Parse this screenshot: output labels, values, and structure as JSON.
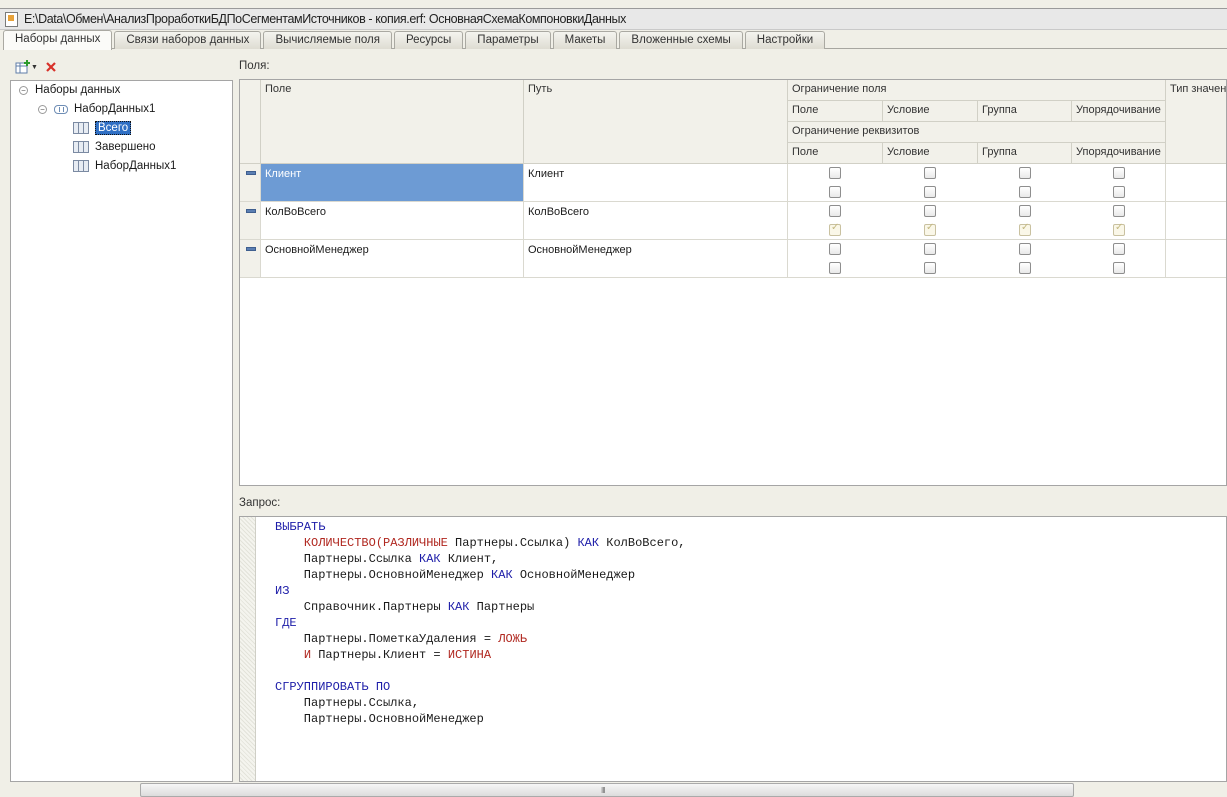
{
  "window": {
    "title": "E:\\Data\\Обмен\\АнализПроработкиБДПоСегментамИсточников - копия.erf: ОсновнаяСхемаКомпоновкиДанных"
  },
  "tabs": [
    {
      "label": "Наборы данных",
      "active": true
    },
    {
      "label": "Связи наборов данных"
    },
    {
      "label": "Вычисляемые поля"
    },
    {
      "label": "Ресурсы"
    },
    {
      "label": "Параметры"
    },
    {
      "label": "Макеты"
    },
    {
      "label": "Вложенные схемы"
    },
    {
      "label": "Настройки"
    }
  ],
  "toolbar": {
    "add_icon": "add-table-icon",
    "delete_icon": "delete-icon"
  },
  "tree": {
    "root": "Наборы данных",
    "dataset": "НаборДанных1",
    "items": [
      "Всего",
      "Завершено",
      "НаборДанных1"
    ],
    "selected": "Всего"
  },
  "fields": {
    "label": "Поля:",
    "headers": {
      "field": "Поле",
      "path": "Путь",
      "restriction_group": "Ограничение поля",
      "restriction_sub": [
        "Поле",
        "Условие",
        "Группа",
        "Упорядочивание"
      ],
      "attr_restriction_group": "Ограничение реквизитов",
      "attr_restriction_sub": [
        "Поле",
        "Условие",
        "Группа",
        "Упорядочивание"
      ],
      "value_type": "Тип значения"
    },
    "rows": [
      {
        "field": "Клиент",
        "path": "Клиент",
        "restriction": [
          false,
          false,
          false,
          false
        ],
        "attr_restriction": [
          false,
          false,
          false,
          false
        ],
        "selected": true
      },
      {
        "field": "КолВоВсего",
        "path": "КолВоВсего",
        "restriction": [
          false,
          false,
          false,
          false
        ],
        "attr_restriction": [
          true,
          true,
          true,
          true
        ]
      },
      {
        "field": "ОсновнойМенеджер",
        "path": "ОсновнойМенеджер",
        "restriction": [
          false,
          false,
          false,
          false
        ],
        "attr_restriction": [
          false,
          false,
          false,
          false
        ]
      }
    ]
  },
  "query": {
    "label": "Запрос:",
    "lines": [
      "ВЫБРАТЬ",
      "    КОЛИЧЕСТВО(РАЗЛИЧНЫЕ Партнеры.Ссылка) КАК КолВоВсего,",
      "    Партнеры.Ссылка КАК Клиент,",
      "    Партнеры.ОсновнойМенеджер КАК ОсновнойМенеджер",
      "ИЗ",
      "    Справочник.Партнеры КАК Партнеры",
      "ГДЕ",
      "    Партнеры.ПометкаУдаления = ЛОЖЬ",
      "    И Партнеры.Клиент = ИСТИНА",
      "",
      "СГРУППИРОВАТЬ ПО",
      "    Партнеры.Ссылка,",
      "    Партнеры.ОсновнойМенеджер"
    ]
  },
  "scrollbar": {
    "grip": "III"
  }
}
